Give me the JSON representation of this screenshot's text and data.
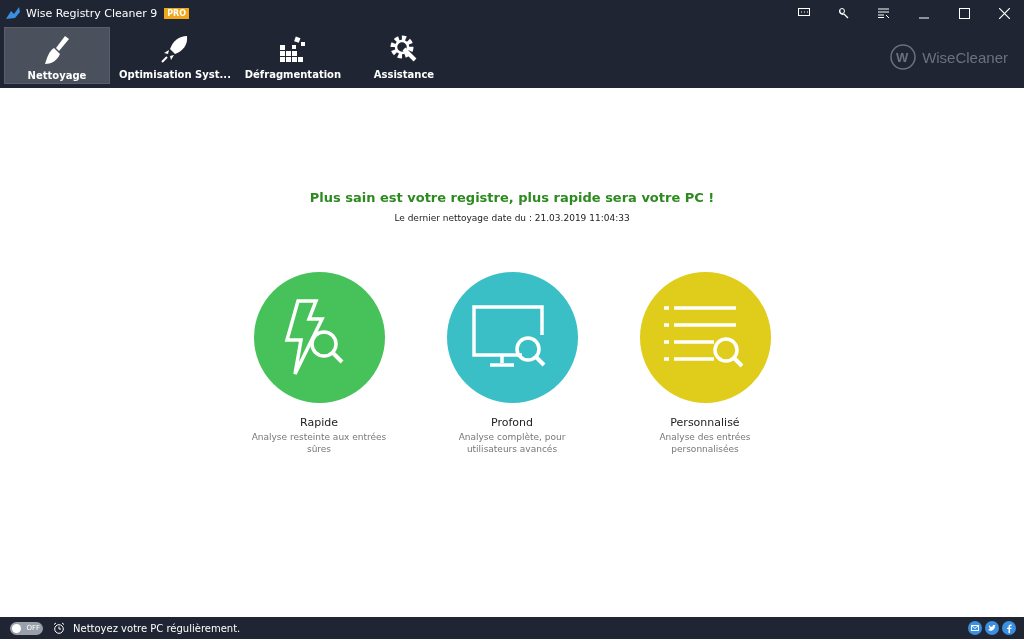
{
  "window": {
    "title": "Wise Registry Cleaner 9",
    "badge": "PRO"
  },
  "tabs": [
    {
      "label": "Nettoyage",
      "kind": "broom",
      "selected": true
    },
    {
      "label": "Optimisation Syst...",
      "kind": "rocket",
      "selected": false
    },
    {
      "label": "Défragmentation",
      "kind": "blocks",
      "selected": false
    },
    {
      "label": "Assistance",
      "kind": "tools",
      "selected": false
    }
  ],
  "brand": "WiseCleaner",
  "brand_logo_letter": "W",
  "headline": "Plus sain est votre registre, plus rapide sera votre PC !",
  "last_clean": "Le dernier nettoyage date du : 21.03.2019 11:04:33",
  "scan_modes": [
    {
      "kind": "bolt",
      "title": "Rapide",
      "description": "Analyse resteinte aux entrées sûres",
      "color": "#47c159"
    },
    {
      "kind": "monitor",
      "title": "Profond",
      "description": "Analyse complète, pour utilisateurs avancés",
      "color": "#3bbfc6"
    },
    {
      "kind": "list",
      "title": "Personnalisé",
      "description": "Analyse des entrées personnalisées",
      "color": "#e0cc1a"
    }
  ],
  "status_bar": {
    "toggle": {
      "label": "OFF",
      "on": false
    },
    "message": "Nettoyez votre PC régulièrement."
  }
}
